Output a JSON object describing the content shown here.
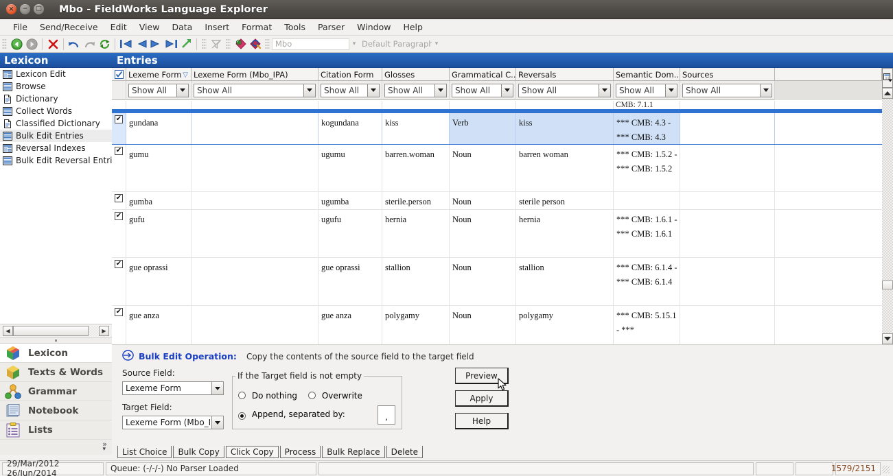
{
  "window": {
    "title": "Mbo - FieldWorks Language Explorer"
  },
  "menu": [
    "File",
    "Send/Receive",
    "Edit",
    "View",
    "Data",
    "Insert",
    "Format",
    "Tools",
    "Parser",
    "Window",
    "Help"
  ],
  "toolbar": {
    "document_combo_value": "Mbo",
    "style_combo_value": "Default Paragraph"
  },
  "sidebar": {
    "header": "Lexicon",
    "items": [
      {
        "label": "Lexicon Edit",
        "icon": "table-blue-icon",
        "selected": false
      },
      {
        "label": "Browse",
        "icon": "table-rows-icon",
        "selected": false
      },
      {
        "label": "Dictionary",
        "icon": "document-icon",
        "selected": false
      },
      {
        "label": "Collect Words",
        "icon": "table-rows-icon",
        "selected": false
      },
      {
        "label": "Classified Dictionary",
        "icon": "document-icon",
        "selected": false
      },
      {
        "label": "Bulk Edit Entries",
        "icon": "table-rows-icon",
        "selected": true
      },
      {
        "label": "Reversal Indexes",
        "icon": "table-blue-icon",
        "selected": false
      },
      {
        "label": "Bulk Edit Reversal Entrie",
        "icon": "table-rows-icon",
        "selected": false
      }
    ],
    "areas": [
      {
        "label": "Lexicon",
        "icon": "cube-multicolor-icon",
        "selected": true
      },
      {
        "label": "Texts & Words",
        "icon": "cube-yellow-icon",
        "selected": false
      },
      {
        "label": "Grammar",
        "icon": "grammar-nodes-icon",
        "selected": false
      },
      {
        "label": "Notebook",
        "icon": "notebook-icon",
        "selected": false
      },
      {
        "label": "Lists",
        "icon": "clipboard-list-icon",
        "selected": false
      }
    ]
  },
  "main": {
    "header": "Entries",
    "columns": [
      {
        "label": "Lexeme Form",
        "sorted": true
      },
      {
        "label": "Lexeme Form (Mbo_IPA)",
        "sorted": false
      },
      {
        "label": "Citation Form",
        "sorted": false
      },
      {
        "label": "Glosses",
        "sorted": false
      },
      {
        "label": "Grammatical C...",
        "sorted": false
      },
      {
        "label": "Reversals",
        "sorted": false
      },
      {
        "label": "Semantic Dom...",
        "sorted": false
      },
      {
        "label": "Sources",
        "sorted": false
      }
    ],
    "filter_value": "Show All",
    "clipped_top_row": {
      "semantic_domain": "CMB: 7.1.1"
    },
    "rows": [
      {
        "checked": true,
        "selected": true,
        "lexeme_form": "gundana",
        "lexeme_form_ipa": "",
        "citation_form": "kogundana",
        "glosses": "kiss",
        "grammatical_category": "Verb",
        "reversals": "kiss",
        "semantic_domains": "*** CMB: 4.3 - *** CMB: 4.3",
        "sources": ""
      },
      {
        "checked": true,
        "selected": false,
        "lexeme_form": "gumu",
        "lexeme_form_ipa": "",
        "citation_form": "ugumu",
        "glosses": "barren.woman",
        "grammatical_category": "Noun",
        "reversals": "barren woman",
        "semantic_domains": "*** CMB: 1.5.2 - *** CMB: 1.5.2",
        "sources": ""
      },
      {
        "checked": true,
        "selected": false,
        "lexeme_form": "gumba",
        "lexeme_form_ipa": "",
        "citation_form": "ugumba",
        "glosses": "sterile.person",
        "grammatical_category": "Noun",
        "reversals": "sterile person",
        "semantic_domains": "",
        "sources": ""
      },
      {
        "checked": true,
        "selected": false,
        "lexeme_form": "gufu",
        "lexeme_form_ipa": "",
        "citation_form": "ugufu",
        "glosses": "hernia",
        "grammatical_category": "Noun",
        "reversals": "hernia",
        "semantic_domains": "*** CMB: 1.6.1 - *** CMB: 1.6.1",
        "sources": ""
      },
      {
        "checked": true,
        "selected": false,
        "lexeme_form": "gue oprassi",
        "lexeme_form_ipa": "",
        "citation_form": "gue oprassi",
        "glosses": "stallion",
        "grammatical_category": "Noun",
        "reversals": "stallion",
        "semantic_domains": "*** CMB: 6.1.4 - *** CMB: 6.1.4",
        "sources": ""
      },
      {
        "checked": true,
        "selected": false,
        "lexeme_form": "gue anza",
        "lexeme_form_ipa": "",
        "citation_form": "gue anza",
        "glosses": "polygamy",
        "grammatical_category": "Noun",
        "reversals": "polygamy",
        "semantic_domains": "*** CMB: 5.15.1 - ***",
        "sources": ""
      }
    ]
  },
  "bulk_edit": {
    "title": "Bulk Edit Operation:",
    "description": "Copy the contents of the source field to the target field",
    "source_field_label": "Source Field:",
    "source_field_value": "Lexeme Form",
    "target_field_label": "Target Field:",
    "target_field_value": "Lexeme Form (Mbo_IPA",
    "fieldset_legend": "If the Target field is not empty",
    "options": [
      {
        "label": "Do nothing",
        "selected": false
      },
      {
        "label": "Overwrite",
        "selected": false
      },
      {
        "label": "Append, separated by:",
        "selected": true
      }
    ],
    "separator_value": ",",
    "buttons": {
      "preview": "Preview",
      "apply": "Apply",
      "help": "Help"
    },
    "tabs": [
      {
        "label": "List Choice",
        "active": false
      },
      {
        "label": "Bulk Copy",
        "active": false
      },
      {
        "label": "Click Copy",
        "active": true
      },
      {
        "label": "Process",
        "active": false
      },
      {
        "label": "Bulk Replace",
        "active": false
      },
      {
        "label": "Delete",
        "active": false
      }
    ]
  },
  "status_bar": {
    "dates": "29/Mar/2012 26/Jun/2014",
    "queue": "Queue: (-/-/-) No Parser Loaded",
    "spacer": "",
    "box1": "",
    "box2": "",
    "record_count": "1579/2151"
  },
  "colors": {
    "title_bar": "#4e4b47",
    "panel_header_blue": "#1c4f9c",
    "selection_blue": "#2e73d2",
    "highlight_cell": "#cfe0f7",
    "link_blue": "#1b3fc4",
    "record_count": "#8a4a22"
  }
}
